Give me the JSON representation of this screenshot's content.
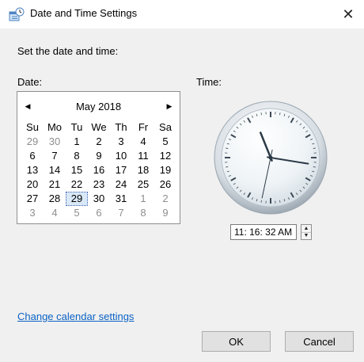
{
  "window": {
    "title": "Date and Time Settings",
    "close_glyph": "✕"
  },
  "heading": "Set the date and time:",
  "date_label": "Date:",
  "time_label": "Time:",
  "calendar": {
    "month_title": "May 2018",
    "weekdays": [
      "Su",
      "Mo",
      "Tu",
      "We",
      "Th",
      "Fr",
      "Sa"
    ],
    "weeks": [
      [
        "29",
        "30",
        "1",
        "2",
        "3",
        "4",
        "5"
      ],
      [
        "6",
        "7",
        "8",
        "9",
        "10",
        "11",
        "12"
      ],
      [
        "13",
        "14",
        "15",
        "16",
        "17",
        "18",
        "19"
      ],
      [
        "20",
        "21",
        "22",
        "23",
        "24",
        "25",
        "26"
      ],
      [
        "27",
        "28",
        "29",
        "30",
        "31",
        "1",
        "2"
      ],
      [
        "3",
        "4",
        "5",
        "6",
        "7",
        "8",
        "9"
      ]
    ],
    "selected_day": "29",
    "prev_icon": "triangle-left-icon",
    "next_icon": "triangle-right-icon"
  },
  "clock": {
    "hour": 11,
    "minute": 16,
    "second": 32
  },
  "time_value": "11: 16: 32 AM",
  "change_calendar_link": "Change calendar settings",
  "buttons": {
    "ok": "OK",
    "cancel": "Cancel"
  },
  "colors": {
    "link": "#0b62c4",
    "selected_bg": "#d9e8f6",
    "window_bg": "#f0f0f0"
  }
}
